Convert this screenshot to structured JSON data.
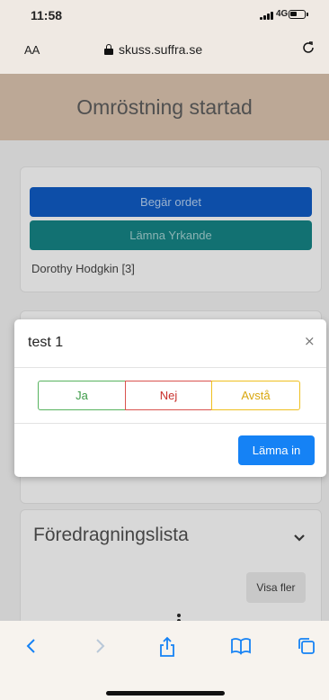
{
  "status_bar": {
    "time": "11:58",
    "network": "4G"
  },
  "address_bar": {
    "text_size_label": "AA",
    "url": "skuss.suffra.se"
  },
  "header": {
    "title": "Omröstning startad"
  },
  "speaker_card": {
    "request_floor_label": "Begär ordet",
    "submit_motion_label": "Lämna Yrkande",
    "speaker": "Dorothy Hodgkin  [3]"
  },
  "vote_modal": {
    "title": "test 1",
    "close_symbol": "×",
    "options": {
      "yes": "Ja",
      "no": "Nej",
      "abstain": "Avstå"
    },
    "submit_label": "Lämna in"
  },
  "agenda": {
    "title": "Föredragningslista",
    "show_more_label": "Visa fler"
  },
  "colors": {
    "primary": "#1582f5",
    "yes": "#57b35f",
    "no": "#d9534f",
    "abstain": "#efc020"
  }
}
